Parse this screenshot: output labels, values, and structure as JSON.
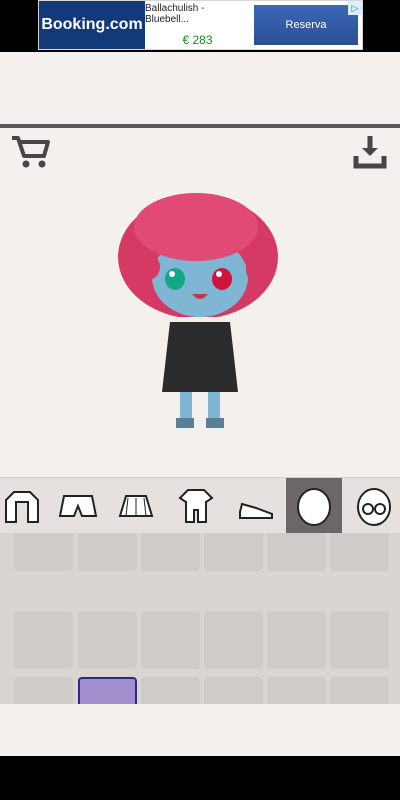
{
  "ad": {
    "brand": "Booking.com",
    "title": "Ballachulish - Bluebell...",
    "price": "€ 283",
    "cta": "Reserva",
    "info_icon": "ad-info-icon"
  },
  "toolbar": {
    "cart_icon": "cart-icon",
    "download_icon": "download-icon"
  },
  "categories": [
    {
      "name": "jacket",
      "icon": "jacket-icon"
    },
    {
      "name": "shorts",
      "icon": "shorts-icon"
    },
    {
      "name": "skirt",
      "icon": "skirt-icon"
    },
    {
      "name": "jumpsuit",
      "icon": "jumpsuit-icon"
    },
    {
      "name": "shoes",
      "icon": "shoe-icon"
    },
    {
      "name": "face",
      "icon": "face-icon"
    },
    {
      "name": "glasses",
      "icon": "glasses-icon"
    }
  ],
  "selected_category": "face",
  "colors": {
    "app_bg": "#f4f0ed",
    "category_active": "#6b6767",
    "selected_tile": "#a28fce",
    "selected_border": "#2b2a86"
  }
}
